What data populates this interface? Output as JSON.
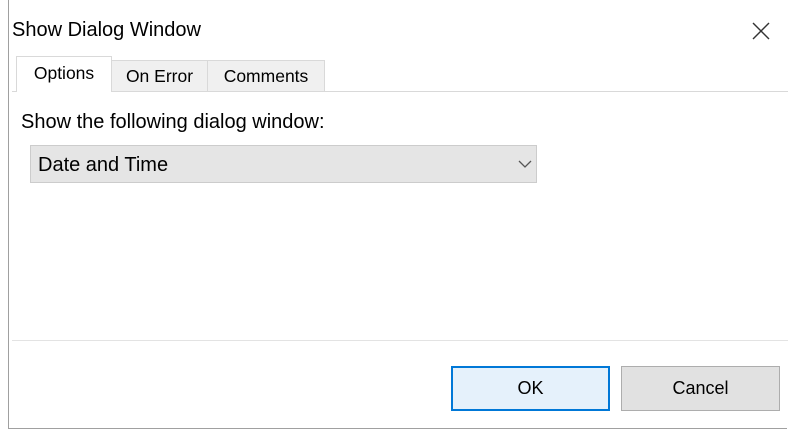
{
  "window": {
    "title": "Show Dialog Window"
  },
  "tabs": [
    {
      "label": "Options",
      "active": true
    },
    {
      "label": "On Error",
      "active": false
    },
    {
      "label": "Comments",
      "active": false
    }
  ],
  "options": {
    "prompt": "Show the following dialog window:",
    "dropdown_value": "Date and Time"
  },
  "buttons": {
    "ok_label": "OK",
    "cancel_label": "Cancel"
  },
  "icons": {
    "close": "close-icon",
    "dropdown": "chevron-down-icon"
  },
  "colors": {
    "accent": "#0078d7",
    "ok_background": "#e5f1fb",
    "dropdown_background": "#e5e5e5"
  }
}
